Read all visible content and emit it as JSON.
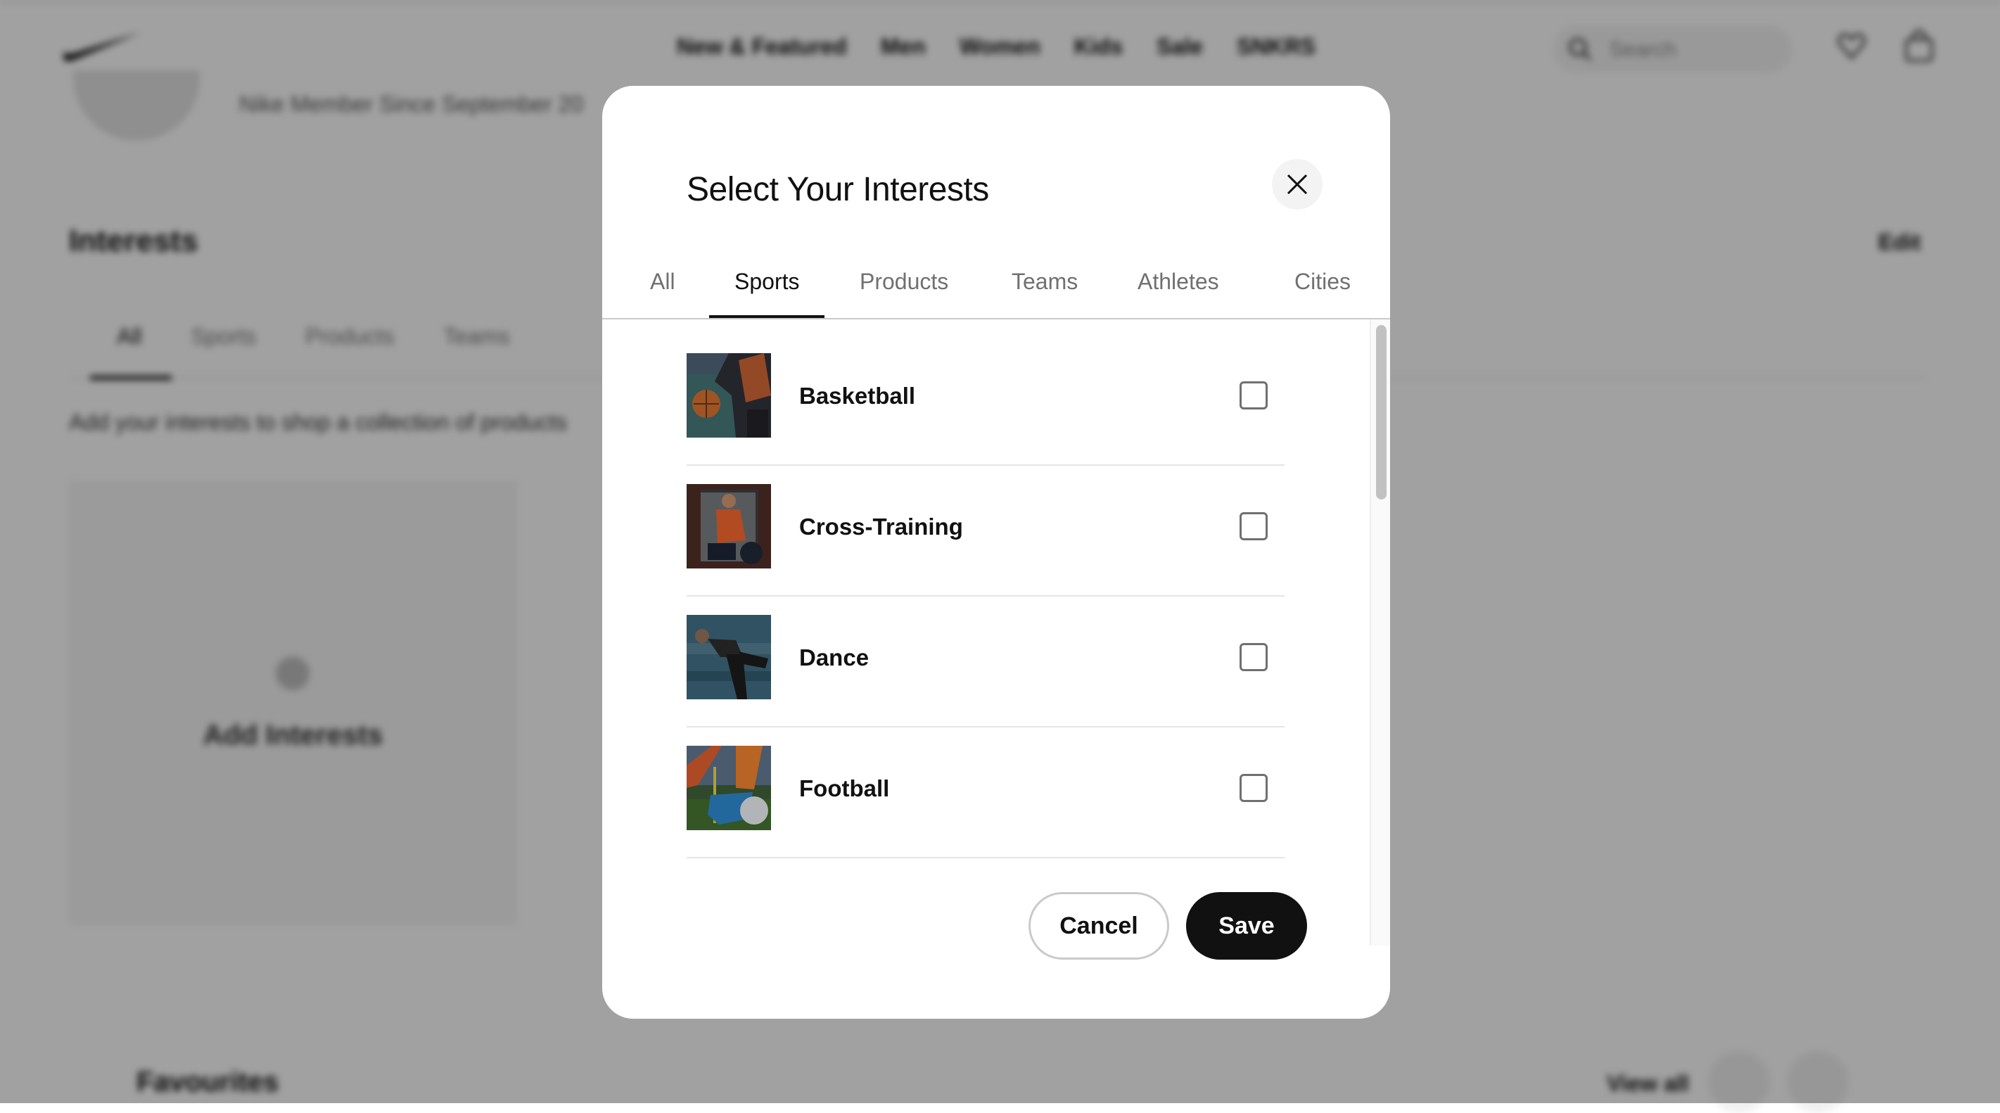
{
  "background_page": {
    "nav": {
      "links": [
        "New & Featured",
        "Men",
        "Women",
        "Kids",
        "Sale",
        "SNKRS"
      ],
      "search_placeholder": "Search"
    },
    "member_text": "Nike Member Since September 20",
    "interests_title": "Interests",
    "edit_label": "Edit",
    "tabs": [
      "All",
      "Sports",
      "Products",
      "Teams"
    ],
    "description": "Add your interests to shop a collection of products",
    "add_interests_label": "Add Interests",
    "favourites_title": "Favourites",
    "view_all_label": "View all"
  },
  "modal": {
    "title": "Select Your Interests",
    "close_icon": "close-icon",
    "tabs": [
      {
        "label": "All",
        "active": false
      },
      {
        "label": "Sports",
        "active": true
      },
      {
        "label": "Products",
        "active": false
      },
      {
        "label": "Teams",
        "active": false
      },
      {
        "label": "Athletes",
        "active": false
      },
      {
        "label": "Cities",
        "active": false
      }
    ],
    "items": [
      {
        "label": "Basketball",
        "checked": false
      },
      {
        "label": "Cross-Training",
        "checked": false
      },
      {
        "label": "Dance",
        "checked": false
      },
      {
        "label": "Football",
        "checked": false
      }
    ],
    "cancel_label": "Cancel",
    "save_label": "Save"
  },
  "colors": {
    "primary": "#111111",
    "secondary_text": "#707072",
    "divider": "#e5e5e5",
    "overlay": "rgba(0,0,0,0.37)"
  }
}
